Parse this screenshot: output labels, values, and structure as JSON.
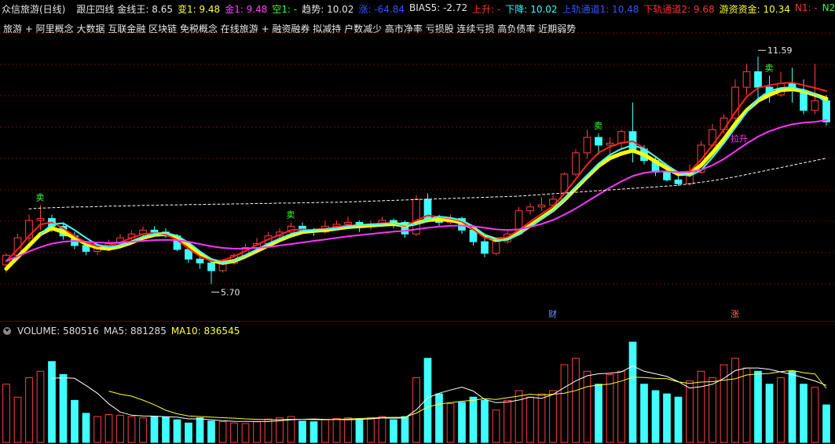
{
  "window_title": "众信旅游(日线)",
  "indicator_name": "跟庄四线",
  "top_metrics": [
    {
      "label": "金线王:",
      "value": "8.65",
      "color": "#e6e6e6"
    },
    {
      "label": "变1:",
      "value": "9.48",
      "color": "#ffff33"
    },
    {
      "label": "金1:",
      "value": "9.48",
      "color": "#ff44ff"
    },
    {
      "label": "空1:",
      "value": "-",
      "color": "#33ff33"
    },
    {
      "label": "趋势:",
      "value": "10.02",
      "color": "#e6e6e6"
    },
    {
      "label": "涨:",
      "value": "-64.84",
      "color": "#3355ff"
    },
    {
      "label": "BIAS5:",
      "value": "-2.72",
      "color": "#e6e6e6"
    },
    {
      "label": "上升:",
      "value": "-",
      "color": "#ff3333"
    },
    {
      "label": "下降:",
      "value": "10.02",
      "color": "#33ffff"
    },
    {
      "label": "上轨通道1:",
      "value": "10.48",
      "color": "#3355ff"
    },
    {
      "label": "下轨通道2:",
      "value": "9.68",
      "color": "#ff3333"
    },
    {
      "label": "游资资金:",
      "value": "10.34",
      "color": "#ffff33"
    },
    {
      "label": "N1:",
      "value": "-",
      "color": "#ff3333"
    },
    {
      "label": "N2:",
      "value": "-",
      "color": "#33ff33"
    }
  ],
  "concepts": "旅游 + 阿里概念 大数据 互联金融 区块链 免税概念 在线旅游 + 融资融券 拟减持 户数减少 高市净率 亏损股 连续亏损 高负债率 近期弱势",
  "volume_header": {
    "volume": {
      "label": "VOLUME:",
      "value": "580516",
      "color": "#e6e6e6"
    },
    "ma5": {
      "label": "MA5:",
      "value": "881285",
      "color": "#e6e6e6"
    },
    "ma10": {
      "label": "MA10:",
      "value": "836545",
      "color": "#ffff33"
    }
  },
  "colors": {
    "up": "#ff4040",
    "down": "#40ffff",
    "grid": "#7a0000",
    "background": "#000000"
  },
  "chart_data": [
    {
      "type": "candlestick",
      "title": "众信旅游(日线)",
      "ylim": [
        5.3,
        12.0
      ],
      "annotations": [
        {
          "text": "11.59",
          "kind": "high",
          "index": 66
        },
        {
          "text": "5.70",
          "kind": "low",
          "index": 18
        },
        {
          "text": "卖",
          "index": 3
        },
        {
          "text": "卖",
          "index": 25
        },
        {
          "text": "卖",
          "index": 52
        },
        {
          "text": "卖",
          "index": 67
        },
        {
          "text": "拉升",
          "index": 64
        },
        {
          "text": "财",
          "index": 48
        },
        {
          "text": "涨",
          "index": 64
        }
      ],
      "candles": [
        [
          6.2,
          6.45,
          6.0,
          6.5
        ],
        [
          6.45,
          6.9,
          6.4,
          7.0
        ],
        [
          6.9,
          7.35,
          6.8,
          7.5
        ],
        [
          7.35,
          7.4,
          7.1,
          7.75
        ],
        [
          7.4,
          7.2,
          7.05,
          7.5
        ],
        [
          7.2,
          6.95,
          6.85,
          7.3
        ],
        [
          6.95,
          6.7,
          6.6,
          7.05
        ],
        [
          6.7,
          6.55,
          6.45,
          6.8
        ],
        [
          6.55,
          6.65,
          6.45,
          6.75
        ],
        [
          6.65,
          6.75,
          6.55,
          6.85
        ],
        [
          6.75,
          6.9,
          6.7,
          7.0
        ],
        [
          6.9,
          7.0,
          6.85,
          7.1
        ],
        [
          7.0,
          7.1,
          6.95,
          7.2
        ],
        [
          7.1,
          7.05,
          6.95,
          7.2
        ],
        [
          7.05,
          6.95,
          6.9,
          7.15
        ],
        [
          6.95,
          6.6,
          6.55,
          7.0
        ],
        [
          6.6,
          6.35,
          6.25,
          6.65
        ],
        [
          6.35,
          6.25,
          6.1,
          6.4
        ],
        [
          6.25,
          6.05,
          5.7,
          6.3
        ],
        [
          6.05,
          6.25,
          6.0,
          6.35
        ],
        [
          6.25,
          6.45,
          6.2,
          6.5
        ],
        [
          6.45,
          6.65,
          6.4,
          6.75
        ],
        [
          6.65,
          6.75,
          6.6,
          6.9
        ],
        [
          6.75,
          6.95,
          6.7,
          7.05
        ],
        [
          6.95,
          7.05,
          6.85,
          7.15
        ],
        [
          7.05,
          7.2,
          6.95,
          7.3
        ],
        [
          7.2,
          7.1,
          7.0,
          7.3
        ],
        [
          7.1,
          7.05,
          6.95,
          7.15
        ],
        [
          7.05,
          7.2,
          7.0,
          7.35
        ],
        [
          7.2,
          7.25,
          7.1,
          7.35
        ],
        [
          7.25,
          7.3,
          7.15,
          7.45
        ],
        [
          7.3,
          7.2,
          7.05,
          7.35
        ],
        [
          7.2,
          7.25,
          7.1,
          7.35
        ],
        [
          7.25,
          7.35,
          7.2,
          7.45
        ],
        [
          7.35,
          7.3,
          7.15,
          7.4
        ],
        [
          7.3,
          7.0,
          6.9,
          7.35
        ],
        [
          7.0,
          7.9,
          6.95,
          8.0
        ],
        [
          7.9,
          7.4,
          7.3,
          8.05
        ],
        [
          7.4,
          7.3,
          7.2,
          7.5
        ],
        [
          7.3,
          7.4,
          7.25,
          7.5
        ],
        [
          7.4,
          7.1,
          7.0,
          7.45
        ],
        [
          7.1,
          6.8,
          6.7,
          7.15
        ],
        [
          6.8,
          6.5,
          6.4,
          6.9
        ],
        [
          6.5,
          6.8,
          6.45,
          6.9
        ],
        [
          6.8,
          7.0,
          6.75,
          7.1
        ],
        [
          7.0,
          7.6,
          6.95,
          7.7
        ],
        [
          7.6,
          7.7,
          7.5,
          7.8
        ],
        [
          7.7,
          7.75,
          7.6,
          7.95
        ],
        [
          7.75,
          7.9,
          7.7,
          8.0
        ],
        [
          7.9,
          8.55,
          7.85,
          8.6
        ],
        [
          8.55,
          9.1,
          8.5,
          9.2
        ],
        [
          9.1,
          9.5,
          8.95,
          9.7
        ],
        [
          9.5,
          9.3,
          9.05,
          9.6
        ],
        [
          9.3,
          9.35,
          9.0,
          9.5
        ],
        [
          9.35,
          9.65,
          9.2,
          9.7
        ],
        [
          9.65,
          9.2,
          8.85,
          10.4
        ],
        [
          9.2,
          8.9,
          8.8,
          9.3
        ],
        [
          8.9,
          8.6,
          8.5,
          9.0
        ],
        [
          8.6,
          8.4,
          8.35,
          8.7
        ],
        [
          8.4,
          8.3,
          8.25,
          8.5
        ],
        [
          8.3,
          8.6,
          8.25,
          8.8
        ],
        [
          8.6,
          9.3,
          8.55,
          9.4
        ],
        [
          9.3,
          9.7,
          9.25,
          9.85
        ],
        [
          9.7,
          10.0,
          9.6,
          10.1
        ],
        [
          10.0,
          10.8,
          9.9,
          11.0
        ],
        [
          10.8,
          11.2,
          10.6,
          11.4
        ],
        [
          11.2,
          10.8,
          10.5,
          11.59
        ],
        [
          10.8,
          10.6,
          10.4,
          11.1
        ],
        [
          10.6,
          10.9,
          10.55,
          11.2
        ],
        [
          10.9,
          10.7,
          10.4,
          11.3
        ],
        [
          10.7,
          10.2,
          10.1,
          11.0
        ],
        [
          10.2,
          10.45,
          10.1,
          11.4
        ],
        [
          10.45,
          9.9,
          9.8,
          10.6
        ]
      ],
      "series": [
        {
          "color": "#ffff00",
          "values": [
            6.1,
            6.4,
            6.7,
            7.0,
            7.15,
            7.05,
            6.9,
            6.75,
            6.65,
            6.62,
            6.68,
            6.78,
            6.9,
            6.98,
            7.0,
            6.92,
            6.72,
            6.5,
            6.32,
            6.25,
            6.3,
            6.42,
            6.56,
            6.7,
            6.84,
            6.96,
            7.05,
            7.08,
            7.1,
            7.14,
            7.18,
            7.2,
            7.22,
            7.24,
            7.26,
            7.22,
            7.28,
            7.36,
            7.38,
            7.36,
            7.3,
            7.15,
            6.95,
            6.85,
            6.88,
            7.02,
            7.22,
            7.42,
            7.62,
            7.88,
            8.18,
            8.48,
            8.76,
            8.96,
            9.08,
            9.16,
            9.05,
            8.88,
            8.7,
            8.55,
            8.56,
            8.78,
            9.1,
            9.45,
            9.85,
            10.2,
            10.45,
            10.6,
            10.72,
            10.75,
            10.7,
            10.6,
            10.5
          ]
        },
        {
          "color": "#ff2020",
          "values": [
            6.3,
            6.6,
            6.95,
            7.25,
            7.3,
            7.15,
            6.95,
            6.78,
            6.68,
            6.7,
            6.78,
            6.9,
            7.0,
            7.02,
            6.98,
            6.85,
            6.62,
            6.42,
            6.3,
            6.32,
            6.42,
            6.56,
            6.72,
            6.86,
            6.98,
            7.1,
            7.12,
            7.1,
            7.14,
            7.18,
            7.22,
            7.22,
            7.24,
            7.28,
            7.28,
            7.2,
            7.35,
            7.48,
            7.44,
            7.4,
            7.32,
            7.12,
            6.9,
            6.86,
            6.92,
            7.1,
            7.32,
            7.52,
            7.72,
            8.05,
            8.42,
            8.8,
            9.1,
            9.26,
            9.36,
            9.4,
            9.22,
            9.0,
            8.78,
            8.6,
            8.62,
            8.92,
            9.3,
            9.7,
            10.15,
            10.55,
            10.78,
            10.85,
            10.9,
            10.92,
            10.85,
            10.78,
            10.7
          ]
        },
        {
          "color": "#40ffff",
          "values": [
            null,
            null,
            null,
            7.0,
            7.25,
            7.28,
            7.1,
            6.9,
            6.72,
            6.66,
            6.7,
            6.8,
            6.92,
            7.0,
            7.02,
            6.95,
            6.78,
            6.55,
            6.35,
            6.26,
            6.3,
            6.45,
            6.6,
            6.75,
            6.88,
            7.0,
            7.08,
            7.1,
            7.12,
            7.15,
            7.2,
            7.22,
            7.24,
            7.26,
            7.28,
            7.22,
            7.26,
            7.38,
            7.45,
            7.42,
            7.35,
            7.2,
            6.98,
            6.85,
            6.85,
            7.0,
            7.2,
            7.4,
            7.6,
            7.9,
            8.2,
            8.52,
            8.82,
            9.05,
            9.2,
            9.3,
            9.2,
            9.0,
            8.78,
            8.58,
            8.5,
            8.65,
            8.98,
            9.35,
            9.75,
            10.15,
            10.5,
            10.7,
            10.78,
            10.8,
            10.72,
            10.62,
            10.4
          ]
        },
        {
          "color": "#ff33ff",
          "values": [
            6.3,
            6.42,
            6.55,
            6.66,
            6.75,
            6.8,
            6.82,
            6.8,
            6.78,
            6.77,
            6.78,
            6.8,
            6.82,
            6.84,
            6.85,
            6.84,
            6.8,
            6.74,
            6.68,
            6.64,
            6.62,
            6.62,
            6.64,
            6.66,
            6.7,
            6.74,
            6.78,
            6.82,
            6.86,
            6.9,
            6.94,
            6.97,
            7.0,
            7.03,
            7.06,
            7.08,
            7.12,
            7.16,
            7.19,
            7.21,
            7.22,
            7.2,
            7.16,
            7.12,
            7.1,
            7.12,
            7.18,
            7.26,
            7.36,
            7.5,
            7.66,
            7.84,
            8.02,
            8.2,
            8.36,
            8.5,
            8.58,
            8.62,
            8.62,
            8.6,
            8.6,
            8.66,
            8.78,
            8.94,
            9.14,
            9.34,
            9.52,
            9.66,
            9.76,
            9.84,
            9.88,
            9.9,
            9.95
          ]
        },
        {
          "color": "#ffffff",
          "dashed": true,
          "values": [
            null,
            null,
            7.65,
            7.67,
            7.68,
            7.69,
            7.7,
            7.7,
            7.71,
            7.72,
            7.72,
            7.73,
            7.74,
            7.74,
            7.75,
            7.75,
            7.76,
            7.76,
            7.77,
            7.77,
            7.78,
            7.78,
            7.79,
            7.79,
            7.8,
            7.8,
            7.81,
            7.81,
            7.82,
            7.82,
            7.83,
            7.84,
            7.85,
            7.86,
            7.87,
            7.88,
            7.89,
            7.9,
            7.91,
            7.92,
            7.93,
            7.94,
            7.95,
            7.96,
            7.97,
            7.98,
            8.0,
            8.02,
            8.04,
            8.06,
            8.08,
            8.1,
            8.12,
            8.14,
            8.16,
            8.18,
            8.2,
            8.22,
            8.24,
            8.26,
            8.3,
            8.34,
            8.38,
            8.43,
            8.48,
            8.54,
            8.6,
            8.66,
            8.72,
            8.78,
            8.84,
            8.9,
            8.96
          ]
        }
      ]
    },
    {
      "type": "bar",
      "title": "VOLUME",
      "ylim": [
        0,
        1600000
      ],
      "values": [
        900000,
        700000,
        1000000,
        1100000,
        1250000,
        1050000,
        650000,
        450000,
        400000,
        430000,
        420000,
        400000,
        380000,
        400000,
        390000,
        350000,
        300000,
        380000,
        330000,
        320000,
        300000,
        290000,
        320000,
        360000,
        380000,
        400000,
        330000,
        320000,
        350000,
        370000,
        380000,
        360000,
        380000,
        400000,
        350000,
        400000,
        1000000,
        1300000,
        750000,
        600000,
        620000,
        700000,
        650000,
        500000,
        650000,
        800000,
        700000,
        750000,
        800000,
        1200000,
        1300000,
        1100000,
        900000,
        1050000,
        1100000,
        1550000,
        900000,
        800000,
        750000,
        700000,
        950000,
        1100000,
        1000000,
        1200000,
        1300000,
        1150000,
        1100000,
        900000,
        1000000,
        1100000,
        900000,
        850000,
        580000
      ],
      "ma5": [
        null,
        null,
        null,
        null,
        990000,
        1000000,
        990000,
        880000,
        760000,
        596000,
        470000,
        420000,
        410000,
        406000,
        398000,
        390000,
        364000,
        364000,
        350000,
        336000,
        326000,
        324000,
        324000,
        322000,
        334000,
        350000,
        358000,
        362000,
        356000,
        354000,
        350000,
        356000,
        364000,
        378000,
        374000,
        380000,
        504000,
        690000,
        760000,
        810000,
        854000,
        794000,
        664000,
        614000,
        624000,
        654000,
        700000,
        680000,
        740000,
        850000,
        950000,
        1030000,
        1060000,
        1070000,
        1090000,
        1180000,
        1100000,
        1060000,
        1020000,
        940000,
        840000,
        860000,
        900000,
        990000,
        1110000,
        1150000,
        1150000,
        1130000,
        1090000,
        1050000,
        1000000,
        950000,
        881285
      ],
      "ma10": [
        null,
        null,
        null,
        null,
        null,
        null,
        null,
        null,
        null,
        793000,
        745000,
        715000,
        653000,
        583000,
        497000,
        443000,
        408000,
        400000,
        392000,
        382000,
        375000,
        364000,
        358000,
        353000,
        352000,
        357000,
        357000,
        351000,
        351000,
        356000,
        363000,
        370000,
        376000,
        386000,
        388000,
        388000,
        455000,
        548000,
        590000,
        616000,
        636000,
        651000,
        677000,
        664000,
        691000,
        716000,
        746000,
        731000,
        746000,
        761000,
        802000,
        862000,
        887000,
        902000,
        948000,
        1008000,
        1002000,
        989000,
        984000,
        934000,
        913000,
        933000,
        939000,
        963000,
        983000,
        1043000,
        1058000,
        1067000,
        1095000,
        1111000,
        1078000,
        1058000,
        836545
      ]
    }
  ]
}
